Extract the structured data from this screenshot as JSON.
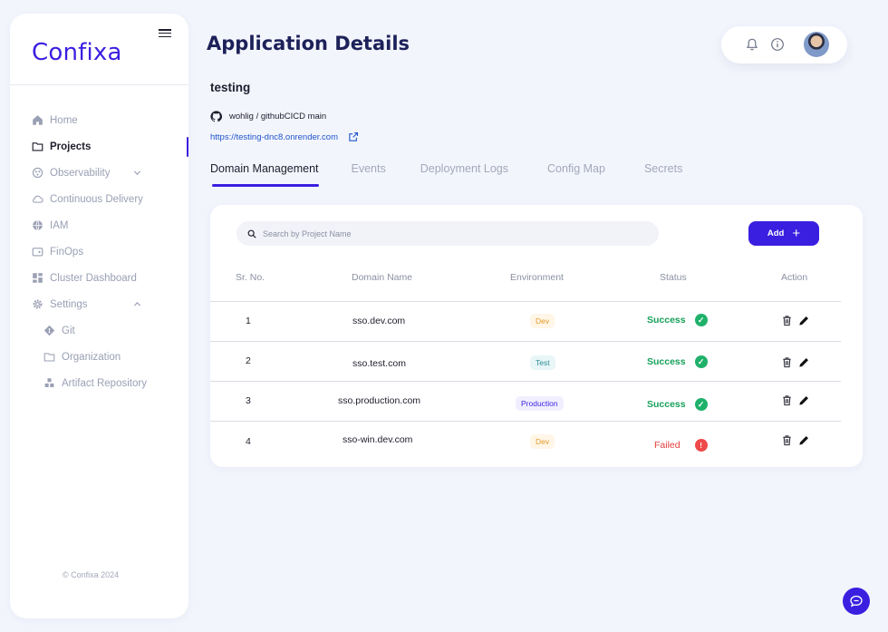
{
  "brand": {
    "logo": "Confixa",
    "accent": "#3a1fe0"
  },
  "sidebar": {
    "items": [
      {
        "label": "Home",
        "icon": "home-icon"
      },
      {
        "label": "Projects",
        "icon": "folder-icon",
        "active": true
      },
      {
        "label": "Observability",
        "icon": "observability-icon",
        "expandable": true
      },
      {
        "label": "Continuous Delivery",
        "icon": "cloud-icon"
      },
      {
        "label": "IAM",
        "icon": "globe-icon"
      },
      {
        "label": "FinOps",
        "icon": "wallet-icon"
      },
      {
        "label": "Cluster Dashboard",
        "icon": "dashboard-icon"
      },
      {
        "label": "Settings",
        "icon": "gear-icon",
        "expanded": true
      }
    ],
    "settings_children": [
      {
        "label": "Git",
        "icon": "git-icon"
      },
      {
        "label": "Organization",
        "icon": "folder-icon"
      },
      {
        "label": "Artifact Repository",
        "icon": "boxes-icon"
      }
    ],
    "copyright": "© Confixa 2024"
  },
  "header": {
    "title": "Application Details"
  },
  "app": {
    "name": "testing",
    "repo": "wohlig / githubCICD main",
    "url": "https://testing-dnc8.onrender.com"
  },
  "tabs": [
    "Domain Management",
    "Events",
    "Deployment Logs",
    "Config Map",
    "Secrets"
  ],
  "search": {
    "placeholder": "Search by Project Name"
  },
  "add_button": {
    "label": "Add"
  },
  "table": {
    "headers": [
      "Sr. No.",
      "Domain Name",
      "Environment",
      "Status",
      "Action"
    ],
    "rows": [
      {
        "sr": "1",
        "domain": "sso.dev.com",
        "env": "Dev",
        "status": "Success"
      },
      {
        "sr": "2",
        "domain": "sso.test.com",
        "env": "Test",
        "status": "Success"
      },
      {
        "sr": "3",
        "domain": "sso.production.com",
        "env": "Production",
        "status": "Success"
      },
      {
        "sr": "4",
        "domain": "sso-win.dev.com",
        "env": "Dev",
        "status": "Failed"
      }
    ]
  },
  "colors": {
    "success": "#16a05a",
    "failed": "#e33b3b",
    "dev": "#e59a2a",
    "test": "#2f8e98",
    "production": "#3a1fe0"
  }
}
